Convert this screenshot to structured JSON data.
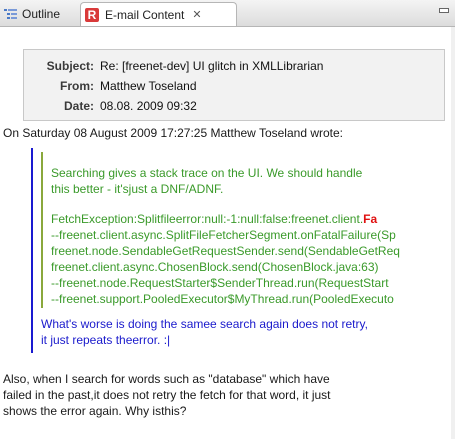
{
  "tabs": {
    "outline_label": "Outline",
    "email_label": "E-mail Content"
  },
  "header": {
    "subject_label": "Subject:",
    "subject_value": "Re: [freenet-dev] UI glitch in XMLLibrarian",
    "from_label": "From:",
    "from_value": "Matthew Toseland",
    "date_label": "Date:",
    "date_value": "08.08. 2009 09:32"
  },
  "body": {
    "attribution": "On Saturday 08 August 2009 17:27:25 Matthew Toseland wrote:",
    "nested_quote": [
      "Searching gives a stack trace on the UI. We should handle",
      "this better - it'sjust a DNF/ADNF."
    ],
    "stack_first_prefix": "FetchException:Splitfileerror:null:-1:null:false:freenet.client.",
    "stack_first_error": "Fa",
    "stack_lines": [
      "--freenet.client.async.SplitFileFetcherSegment.onFatalFailure(Sp",
      "freenet.node.SendableGetRequestSender.send(SendableGetReq",
      "freenet.client.async.ChosenBlock.send(ChosenBlock.java:63)",
      "--freenet.node.RequestStarter$SenderThread.run(RequestStart",
      "--freenet.support.PooledExecutor$MyThread.run(PooledExecuto"
    ],
    "quote_reply": [
      "What's worse is doing the samee search again does not retry,",
      "it just repeats theerror. :|"
    ],
    "reply": [
      "Also, when I search for words such as \"database\" which have",
      "failed in the past,it does not retry the fetch for that word, it just",
      "shows the error again. Why isthis?"
    ]
  },
  "colors": {
    "outer_quote_bar": "#1a1ad0",
    "inner_quote_bar": "#8aa83c",
    "inner_quote_text": "#3a9a2a",
    "outer_quote_text": "#1a1acc",
    "error_text": "#e01010"
  }
}
